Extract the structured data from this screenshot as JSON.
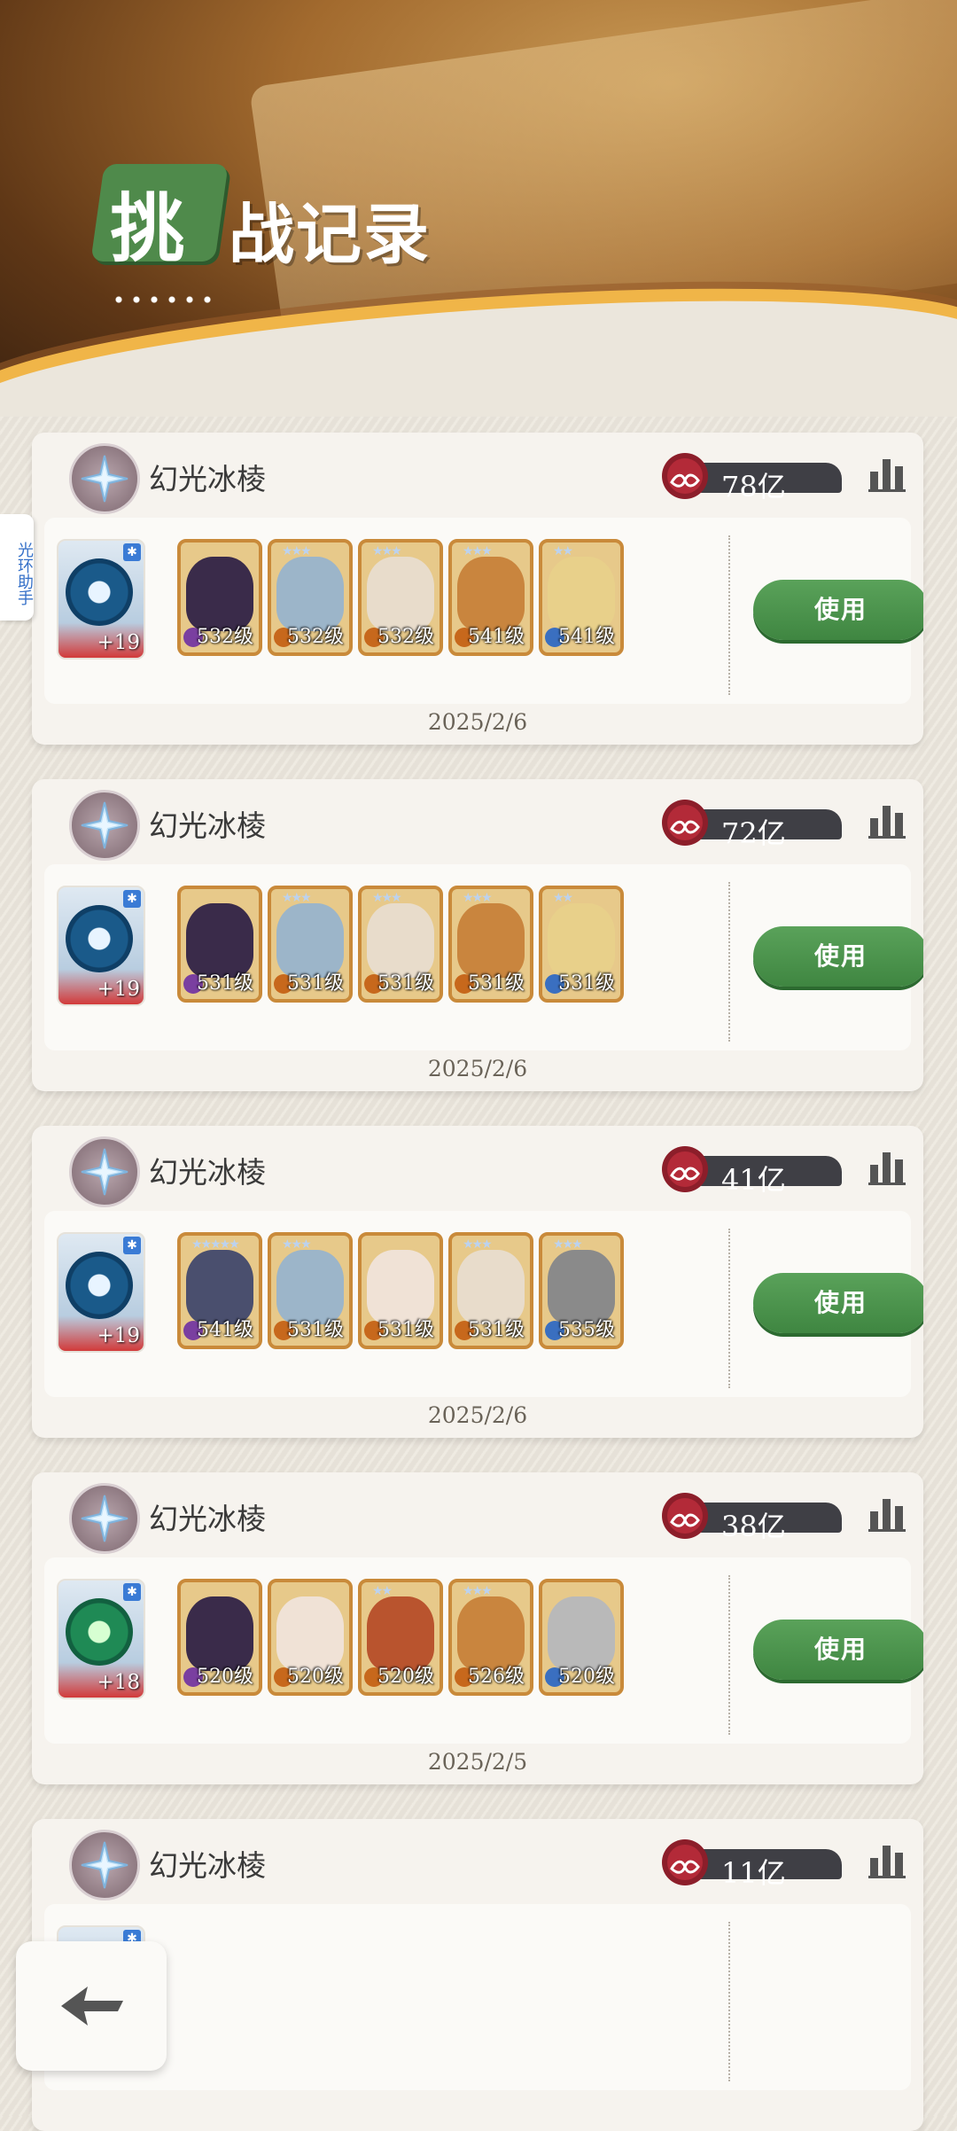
{
  "header": {
    "title_first_char": "挑",
    "title_rest": "战记录"
  },
  "side_tab": {
    "label": "光环助手"
  },
  "records": [
    {
      "boss": "幻光冰棱",
      "score": "78亿",
      "date": "2025/2/6",
      "button": "使用",
      "artifact": {
        "plus": "+19",
        "rune": "blue"
      },
      "heroes": [
        {
          "level": "532级",
          "stars": "",
          "color": "#3a2b4a"
        },
        {
          "level": "532级",
          "stars": "★★★",
          "color": "#9cb5c9"
        },
        {
          "level": "532级",
          "stars": "★★★",
          "color": "#e8dccb"
        },
        {
          "level": "541级",
          "stars": "★★★",
          "color": "#c9853e"
        },
        {
          "level": "541级",
          "stars": "★★",
          "color": "#e8d08a"
        }
      ]
    },
    {
      "boss": "幻光冰棱",
      "score": "72亿",
      "date": "2025/2/6",
      "button": "使用",
      "artifact": {
        "plus": "+19",
        "rune": "blue"
      },
      "heroes": [
        {
          "level": "531级",
          "stars": "",
          "color": "#3a2b4a"
        },
        {
          "level": "531级",
          "stars": "★★★",
          "color": "#9cb5c9"
        },
        {
          "level": "531级",
          "stars": "★★★",
          "color": "#e8dccb"
        },
        {
          "level": "531级",
          "stars": "★★★",
          "color": "#c9853e"
        },
        {
          "level": "531级",
          "stars": "★★",
          "color": "#e8d08a"
        }
      ]
    },
    {
      "boss": "幻光冰棱",
      "score": "41亿",
      "date": "2025/2/6",
      "button": "使用",
      "artifact": {
        "plus": "+19",
        "rune": "blue"
      },
      "heroes": [
        {
          "level": "541级",
          "stars": "★★★★★",
          "color": "#4a4f6e"
        },
        {
          "level": "531级",
          "stars": "★★★",
          "color": "#9cb5c9"
        },
        {
          "level": "531级",
          "stars": "",
          "color": "#f0e2d6"
        },
        {
          "level": "531级",
          "stars": "★★★",
          "color": "#e8dccb"
        },
        {
          "level": "535级",
          "stars": "★★★",
          "color": "#8a8a8a"
        }
      ]
    },
    {
      "boss": "幻光冰棱",
      "score": "38亿",
      "date": "2025/2/5",
      "button": "使用",
      "artifact": {
        "plus": "+18",
        "rune": "green"
      },
      "heroes": [
        {
          "level": "520级",
          "stars": "",
          "color": "#3a2b4a"
        },
        {
          "level": "520级",
          "stars": "",
          "color": "#f0e2d6"
        },
        {
          "level": "520级",
          "stars": "★★",
          "color": "#b9542e"
        },
        {
          "level": "526级",
          "stars": "★★★",
          "color": "#c9853e"
        },
        {
          "level": "520级",
          "stars": "",
          "color": "#b9b9b9"
        }
      ]
    },
    {
      "boss": "幻光冰棱",
      "score": "11亿",
      "date": "",
      "button": "",
      "artifact": {
        "plus": "",
        "rune": "blue"
      },
      "heroes": []
    }
  ],
  "colors": {
    "accent_green": "#4f8a4b",
    "card_bg": "#f6f3ee",
    "hero_frame": "#c98a3a"
  },
  "icons": {
    "back": "back-arrow-icon",
    "rank": "bar-chart-icon",
    "boss": "ice-star-icon",
    "score": "infinity-emblem-icon"
  }
}
